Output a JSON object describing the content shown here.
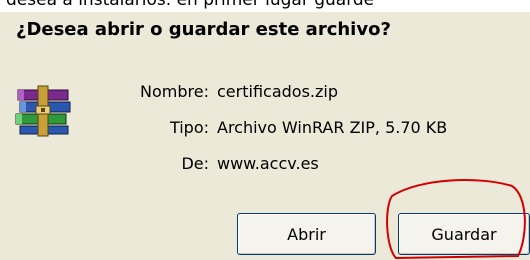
{
  "clipped_top_text": "desea a instalarlos. en primer lugar guarde",
  "dialog": {
    "question": "¿Desea abrir o guardar este archivo?",
    "file_icon": "winrar-archive-icon",
    "fields": {
      "name_label": "Nombre:",
      "name_value": "certificados.zip",
      "type_label": "Tipo:",
      "type_value": "Archivo WinRAR ZIP, 5.70 KB",
      "from_label": "De:",
      "from_value": "www.accv.es"
    },
    "buttons": {
      "open_label": "Abrir",
      "save_label": "Guardar"
    }
  },
  "colors": {
    "dialog_background": "#ece9d8",
    "highlight_circle": "#d40000"
  }
}
